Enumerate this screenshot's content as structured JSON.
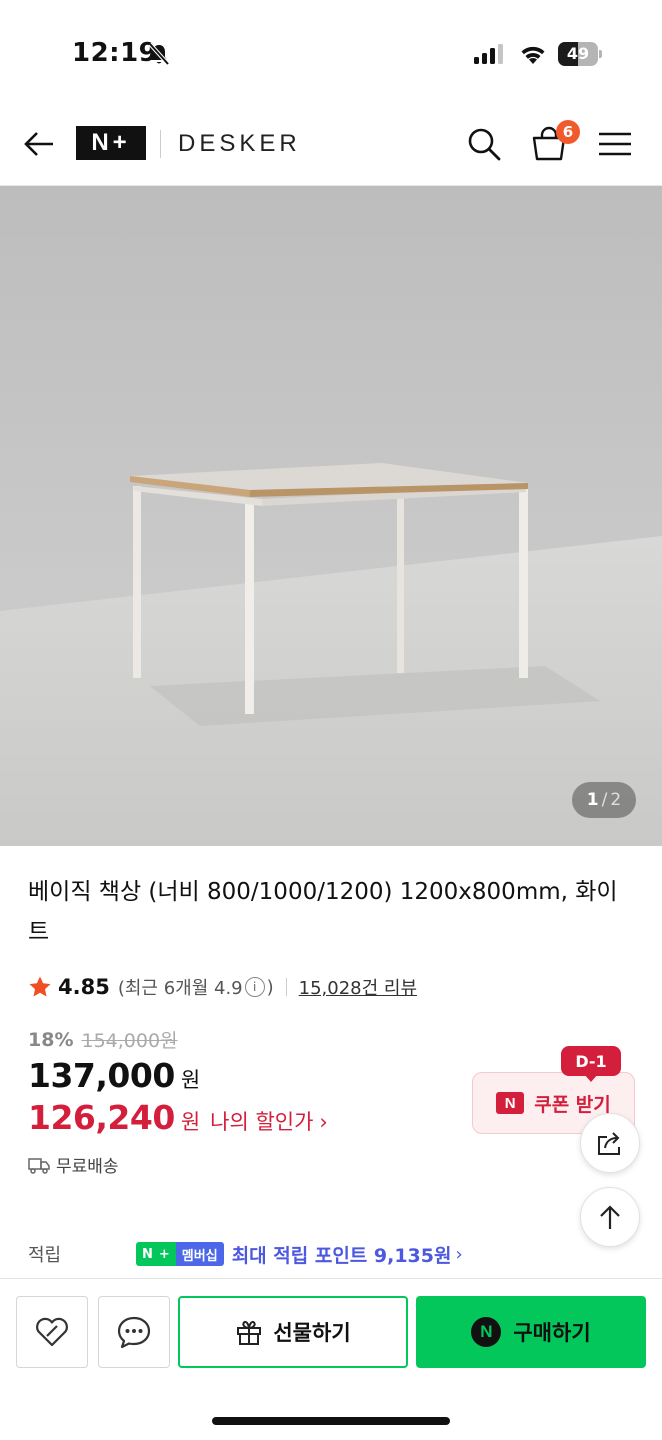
{
  "status_bar": {
    "time": "12:19",
    "battery": "49",
    "battery_level": 0.49
  },
  "header": {
    "brand_logo": "N+",
    "brand_name": "DESKER",
    "cart_count": "6"
  },
  "image": {
    "current": "1",
    "separator": "/",
    "total": "2"
  },
  "product": {
    "title": "베이직 책상 (너비 800/1000/1200) 1200x800mm, 화이트",
    "rating": "4.85",
    "recent_rating_prefix": "(최근 6개월 4.9",
    "recent_rating_suffix": ")",
    "info_glyph": "i",
    "review_count": "15,028건 리뷰",
    "discount_rate": "18%",
    "original_price": "154,000원",
    "sale_price": "137,000",
    "currency": "원",
    "member_price": "126,240",
    "member_currency": "원",
    "member_label": "나의 할인가",
    "member_arrow": "›",
    "shipping": "무료배송"
  },
  "coupon": {
    "dday": "D-1",
    "icon_letter": "N",
    "label": "쿠폰 받기"
  },
  "points": {
    "label": "적립",
    "badge_n": "N",
    "badge_plus": "+",
    "badge_text": "멤버십",
    "text": "최대 적립 포인트 9,135원",
    "arrow": "›"
  },
  "bottom_bar": {
    "gift_label": "선물하기",
    "buy_label": "구매하기",
    "npay_letter": "N"
  },
  "colors": {
    "naver_green": "#03c75a",
    "discount_red": "#d41f3c",
    "points_blue": "#4c58df",
    "star": "#f04e23"
  }
}
